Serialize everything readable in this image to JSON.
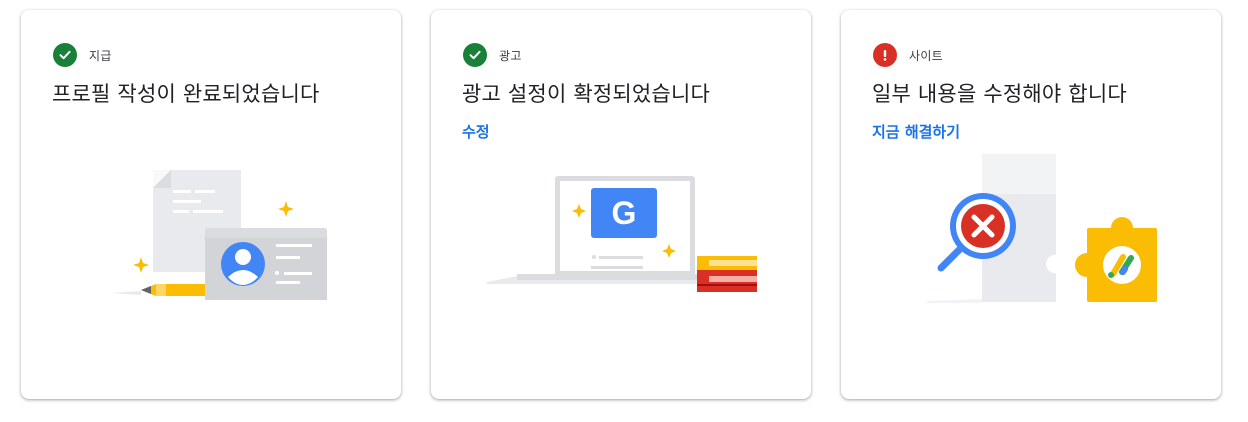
{
  "colors": {
    "success": "#188038",
    "error": "#d93025",
    "link": "#1a73e8",
    "title": "#202124"
  },
  "cards": [
    {
      "status": "success",
      "status_icon": "check-circle-icon",
      "label": "지급",
      "title": "프로필 작성이 완료되었습니다",
      "link": null
    },
    {
      "status": "success",
      "status_icon": "check-circle-icon",
      "label": "광고",
      "title": "광고 설정이 확정되었습니다",
      "link": "수정",
      "illustration_logo": "G"
    },
    {
      "status": "error",
      "status_icon": "exclamation-circle-icon",
      "label": "사이트",
      "title": "일부 내용을 수정해야 합니다",
      "link": "지금 해결하기"
    }
  ]
}
